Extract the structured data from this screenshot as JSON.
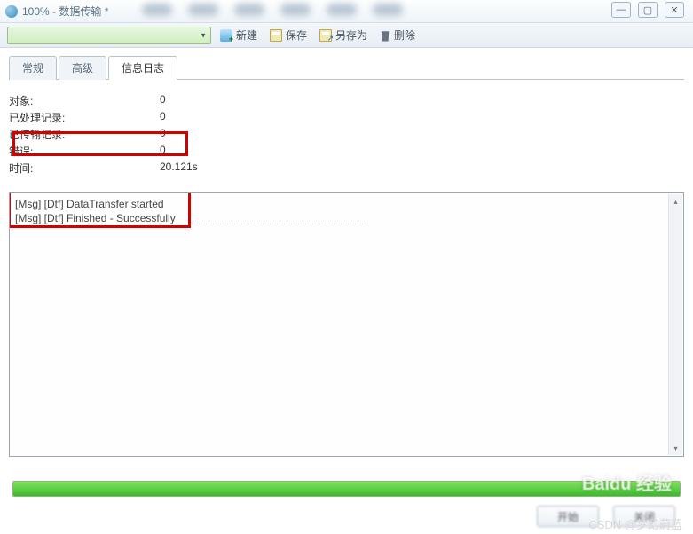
{
  "title": "100% - 数据传输 *",
  "toolbar": {
    "new_label": "新建",
    "save_label": "保存",
    "save_as_label": "另存为",
    "delete_label": "删除"
  },
  "tabs": [
    "常规",
    "高级",
    "信息日志"
  ],
  "active_tab_index": 2,
  "stats": [
    {
      "label": "对象:",
      "value": "0"
    },
    {
      "label": "已处理记录:",
      "value": "0"
    },
    {
      "label": "已传输记录:",
      "value": "0"
    },
    {
      "label": "错误:",
      "value": "0"
    },
    {
      "label": "时间:",
      "value": "20.121s"
    }
  ],
  "log_lines": [
    "[Msg] [Dtf] DataTransfer started",
    "[Msg] [Dtf] Finished - Successfully"
  ],
  "progress_percent": 100,
  "buttons": {
    "start": "开始",
    "close": "关闭"
  },
  "watermark_logo": "Baidu 经验",
  "watermark_csdn": "CSDN @梦幻蔚蓝"
}
